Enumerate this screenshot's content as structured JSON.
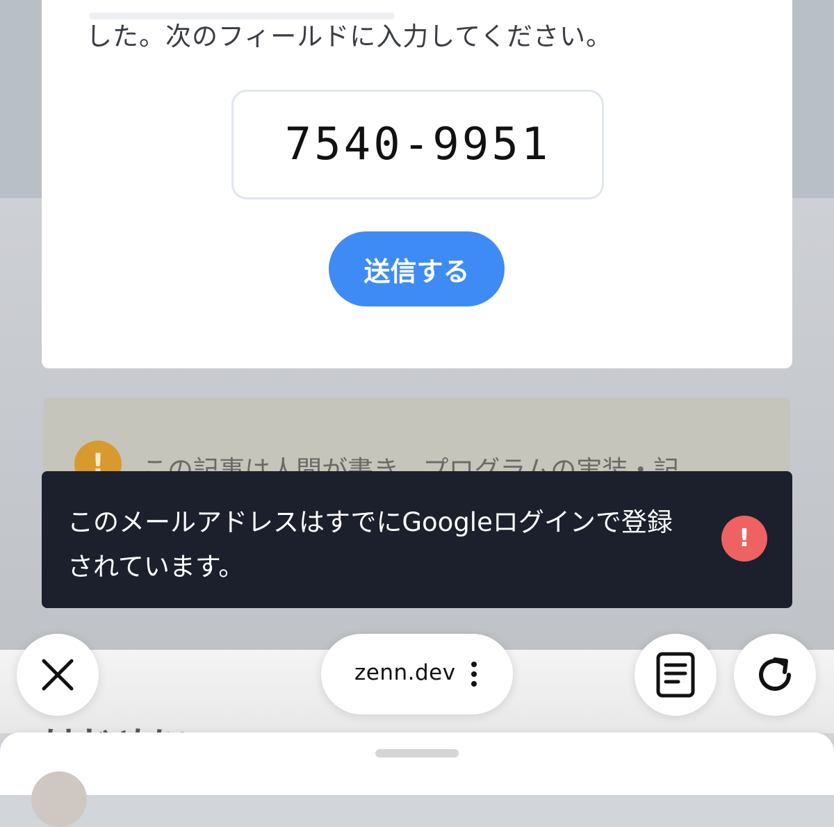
{
  "article": {
    "instruction": "した。次のフィールドに入力してください。",
    "code": "7540-9951",
    "submit_label": "送信する",
    "notice_text": "この記事は人間が書き、プログラムの実装・記",
    "notice_icon": "warning-icon",
    "heading_partial": "はじめに"
  },
  "toast": {
    "message": "このメールアドレスはすでにGoogleログインで登録されています。",
    "icon": "error-icon",
    "color": "#1b202c",
    "icon_color": "#ef6262"
  },
  "browser": {
    "url": "zenn.dev",
    "close_icon": "close-icon",
    "menu_icon": "more-vertical-icon",
    "reader_icon": "reader-mode-icon",
    "reload_icon": "reload-icon"
  },
  "colors": {
    "accent": "#3e8bf5",
    "notice_icon": "#d89a2c"
  }
}
